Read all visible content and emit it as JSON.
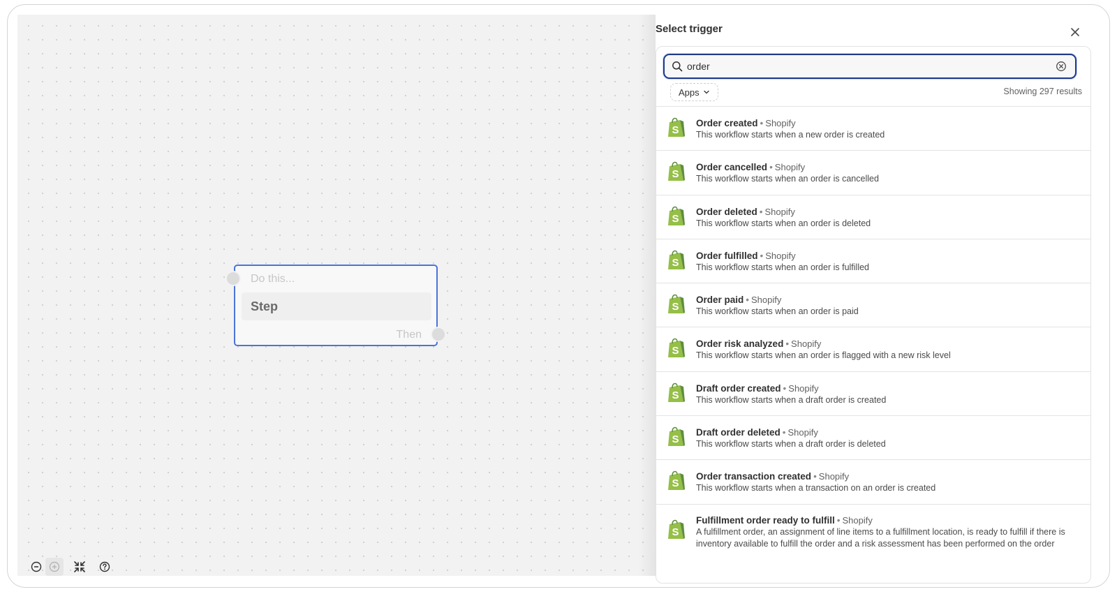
{
  "canvas": {
    "node": {
      "placeholder": "Do this...",
      "label": "Step",
      "then": "Then"
    }
  },
  "panel": {
    "title": "Select trigger",
    "search": {
      "value": "order",
      "placeholder": ""
    },
    "filter": {
      "apps_label": "Apps"
    },
    "results_count": "Showing 297 results",
    "items": [
      {
        "name": "Order created",
        "app": "Shopify",
        "desc": "This workflow starts when a new order is created"
      },
      {
        "name": "Order cancelled",
        "app": "Shopify",
        "desc": "This workflow starts when an order is cancelled"
      },
      {
        "name": "Order deleted",
        "app": "Shopify",
        "desc": "This workflow starts when an order is deleted"
      },
      {
        "name": "Order fulfilled",
        "app": "Shopify",
        "desc": "This workflow starts when an order is fulfilled"
      },
      {
        "name": "Order paid",
        "app": "Shopify",
        "desc": "This workflow starts when an order is paid"
      },
      {
        "name": "Order risk analyzed",
        "app": "Shopify",
        "desc": "This workflow starts when an order is flagged with a new risk level"
      },
      {
        "name": "Draft order created",
        "app": "Shopify",
        "desc": "This workflow starts when a draft order is created"
      },
      {
        "name": "Draft order deleted",
        "app": "Shopify",
        "desc": "This workflow starts when a draft order is deleted"
      },
      {
        "name": "Order transaction created",
        "app": "Shopify",
        "desc": "This workflow starts when a transaction on an order is created"
      },
      {
        "name": "Fulfillment order ready to fulfill",
        "app": "Shopify",
        "desc": "A fulfillment order, an assignment of line items to a fulfillment location, is ready to fulfill if there is inventory available to fulfill the order and a risk assessment has been performed on the order"
      }
    ],
    "separator": "•"
  },
  "icons": {
    "zoom_out": "zoom-out-icon",
    "zoom_in": "zoom-in-icon",
    "fit": "fit-view-icon",
    "help": "help-icon",
    "close": "close-icon",
    "search": "search-icon",
    "clear": "clear-icon",
    "chevron": "chevron-down-icon",
    "app_logo": "shopify-bag-icon"
  },
  "colors": {
    "accent": "#4a74d9",
    "search_border": "#1f3a8a",
    "shopify_green": "#95bf47"
  }
}
